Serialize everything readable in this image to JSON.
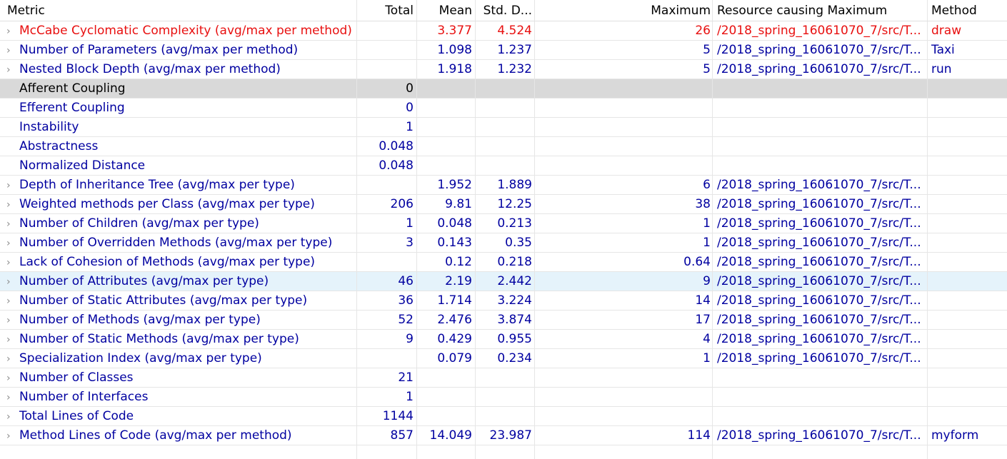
{
  "headers": {
    "metric": "Metric",
    "total": "Total",
    "mean": "Mean",
    "std": "Std. D...",
    "max": "Maximum",
    "resource": "Resource causing Maximum",
    "method": "Method"
  },
  "colors": {
    "link_blue": "#0000a0",
    "error_red": "#e81010",
    "selected_gray": "#d9d9d9",
    "hover_blue": "#e5f3fb"
  },
  "icons": {
    "expand": "chevron-right-icon"
  },
  "rows": [
    {
      "metric": "McCabe Cyclomatic Complexity (avg/max per method)",
      "total": "",
      "mean": "3.377",
      "std": "4.524",
      "max": "26",
      "resource": "/2018_spring_16061070_7/src/T...",
      "method": "draw",
      "expandable": true,
      "style": "red"
    },
    {
      "metric": "Number of Parameters (avg/max per method)",
      "total": "",
      "mean": "1.098",
      "std": "1.237",
      "max": "5",
      "resource": "/2018_spring_16061070_7/src/T...",
      "method": "Taxi",
      "expandable": true,
      "style": ""
    },
    {
      "metric": "Nested Block Depth (avg/max per method)",
      "total": "",
      "mean": "1.918",
      "std": "1.232",
      "max": "5",
      "resource": "/2018_spring_16061070_7/src/T...",
      "method": "run",
      "expandable": true,
      "style": ""
    },
    {
      "metric": "Afferent Coupling",
      "total": "0",
      "mean": "",
      "std": "",
      "max": "",
      "resource": "",
      "method": "",
      "expandable": false,
      "style": "sel-gray"
    },
    {
      "metric": "Efferent Coupling",
      "total": "0",
      "mean": "",
      "std": "",
      "max": "",
      "resource": "",
      "method": "",
      "expandable": false,
      "style": ""
    },
    {
      "metric": "Instability",
      "total": "1",
      "mean": "",
      "std": "",
      "max": "",
      "resource": "",
      "method": "",
      "expandable": false,
      "style": ""
    },
    {
      "metric": "Abstractness",
      "total": "0.048",
      "mean": "",
      "std": "",
      "max": "",
      "resource": "",
      "method": "",
      "expandable": false,
      "style": ""
    },
    {
      "metric": "Normalized Distance",
      "total": "0.048",
      "mean": "",
      "std": "",
      "max": "",
      "resource": "",
      "method": "",
      "expandable": false,
      "style": ""
    },
    {
      "metric": "Depth of Inheritance Tree (avg/max per type)",
      "total": "",
      "mean": "1.952",
      "std": "1.889",
      "max": "6",
      "resource": "/2018_spring_16061070_7/src/T...",
      "method": "",
      "expandable": true,
      "style": ""
    },
    {
      "metric": "Weighted methods per Class (avg/max per type)",
      "total": "206",
      "mean": "9.81",
      "std": "12.25",
      "max": "38",
      "resource": "/2018_spring_16061070_7/src/T...",
      "method": "",
      "expandable": true,
      "style": ""
    },
    {
      "metric": "Number of Children (avg/max per type)",
      "total": "1",
      "mean": "0.048",
      "std": "0.213",
      "max": "1",
      "resource": "/2018_spring_16061070_7/src/T...",
      "method": "",
      "expandable": true,
      "style": ""
    },
    {
      "metric": "Number of Overridden Methods (avg/max per type)",
      "total": "3",
      "mean": "0.143",
      "std": "0.35",
      "max": "1",
      "resource": "/2018_spring_16061070_7/src/T...",
      "method": "",
      "expandable": true,
      "style": ""
    },
    {
      "metric": "Lack of Cohesion of Methods (avg/max per type)",
      "total": "",
      "mean": "0.12",
      "std": "0.218",
      "max": "0.64",
      "resource": "/2018_spring_16061070_7/src/T...",
      "method": "",
      "expandable": true,
      "style": ""
    },
    {
      "metric": "Number of Attributes (avg/max per type)",
      "total": "46",
      "mean": "2.19",
      "std": "2.442",
      "max": "9",
      "resource": "/2018_spring_16061070_7/src/T...",
      "method": "",
      "expandable": true,
      "style": "hl-blue"
    },
    {
      "metric": "Number of Static Attributes (avg/max per type)",
      "total": "36",
      "mean": "1.714",
      "std": "3.224",
      "max": "14",
      "resource": "/2018_spring_16061070_7/src/T...",
      "method": "",
      "expandable": true,
      "style": ""
    },
    {
      "metric": "Number of Methods (avg/max per type)",
      "total": "52",
      "mean": "2.476",
      "std": "3.874",
      "max": "17",
      "resource": "/2018_spring_16061070_7/src/T...",
      "method": "",
      "expandable": true,
      "style": ""
    },
    {
      "metric": "Number of Static Methods (avg/max per type)",
      "total": "9",
      "mean": "0.429",
      "std": "0.955",
      "max": "4",
      "resource": "/2018_spring_16061070_7/src/T...",
      "method": "",
      "expandable": true,
      "style": ""
    },
    {
      "metric": "Specialization Index (avg/max per type)",
      "total": "",
      "mean": "0.079",
      "std": "0.234",
      "max": "1",
      "resource": "/2018_spring_16061070_7/src/T...",
      "method": "",
      "expandable": true,
      "style": ""
    },
    {
      "metric": "Number of Classes",
      "total": "21",
      "mean": "",
      "std": "",
      "max": "",
      "resource": "",
      "method": "",
      "expandable": true,
      "style": ""
    },
    {
      "metric": "Number of Interfaces",
      "total": "1",
      "mean": "",
      "std": "",
      "max": "",
      "resource": "",
      "method": "",
      "expandable": true,
      "style": ""
    },
    {
      "metric": "Total Lines of Code",
      "total": "1144",
      "mean": "",
      "std": "",
      "max": "",
      "resource": "",
      "method": "",
      "expandable": true,
      "style": ""
    },
    {
      "metric": "Method Lines of Code (avg/max per method)",
      "total": "857",
      "mean": "14.049",
      "std": "23.987",
      "max": "114",
      "resource": "/2018_spring_16061070_7/src/T...",
      "method": "myform",
      "expandable": true,
      "style": ""
    }
  ]
}
